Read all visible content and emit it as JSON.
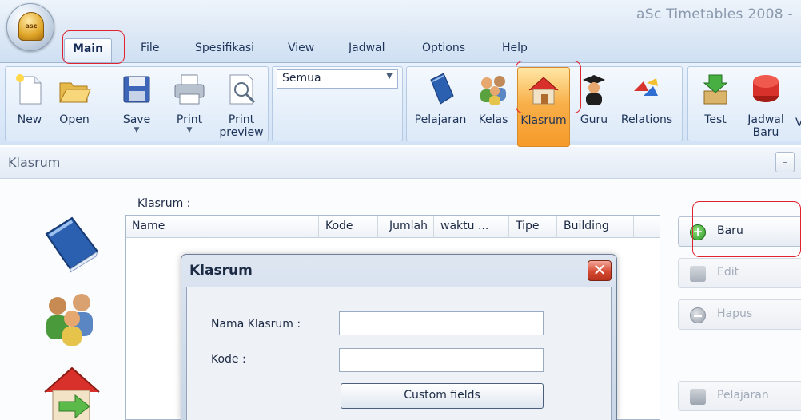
{
  "app": {
    "title": "aSc Timetables 2008  -",
    "orb_text": "asc"
  },
  "tabs": [
    {
      "label": "Main"
    },
    {
      "label": "File"
    },
    {
      "label": "Spesifikasi"
    },
    {
      "label": "View"
    },
    {
      "label": "Jadwal"
    },
    {
      "label": "Options"
    },
    {
      "label": "Help"
    }
  ],
  "ribbon": {
    "new": "New",
    "open": "Open",
    "save": "Save",
    "print": "Print",
    "print_preview": "Print preview",
    "filter_value": "Semua",
    "pelajaran": "Pelajaran",
    "kelas": "Kelas",
    "klasrum": "Klasrum",
    "guru": "Guru",
    "relations": "Relations",
    "test": "Test",
    "jadwal_baru": "Jadwal Baru",
    "cut": "V"
  },
  "window": {
    "title": "Klasrum",
    "minimize": "–"
  },
  "list": {
    "label": "Klasrum :",
    "columns": [
      "Name",
      "Kode",
      "Jumlah",
      "waktu ...",
      "Tipe",
      "Building"
    ]
  },
  "actions": {
    "baru": "Baru",
    "edit": "Edit",
    "hapus": "Hapus",
    "pelajaran": "Pelajaran"
  },
  "dialog": {
    "title": "Klasrum",
    "nama_label": "Nama Klasrum :",
    "nama_value": "",
    "kode_label": "Kode :",
    "kode_value": "",
    "custom_fields": "Custom fields"
  },
  "colors": {
    "annotation": "#e0242e",
    "selected_ribbon": "#f8b04a",
    "close_button": "#d64a32"
  }
}
